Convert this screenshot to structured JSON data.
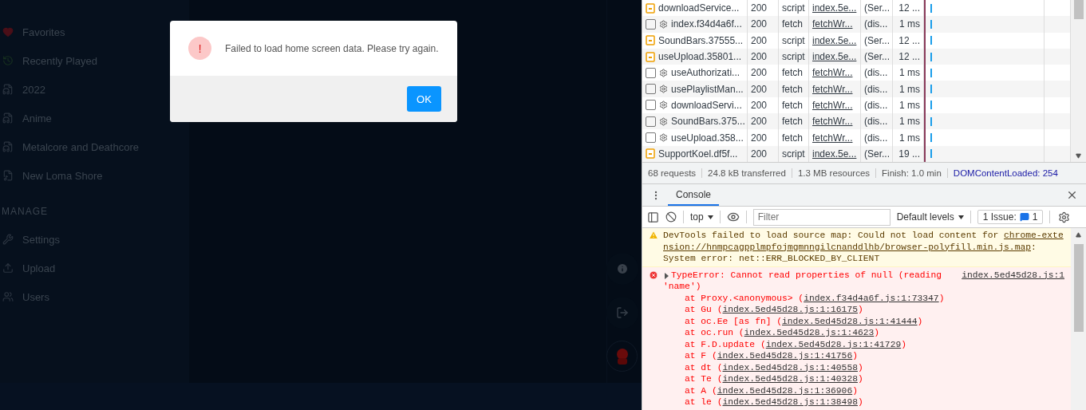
{
  "sidebar": {
    "items": [
      {
        "label": "Favorites",
        "kind": "favorites"
      },
      {
        "label": "Recently Played",
        "kind": "recent"
      },
      {
        "label": "2022",
        "kind": "smart"
      },
      {
        "label": "Anime",
        "kind": "smart"
      },
      {
        "label": "Metalcore and Deathcore",
        "kind": "smart"
      },
      {
        "label": "New Loma Shore",
        "kind": "playlist"
      }
    ],
    "manage_heading": "MANAGE",
    "manage_items": [
      {
        "label": "Settings",
        "kind": "settings"
      },
      {
        "label": "Upload",
        "kind": "upload"
      },
      {
        "label": "Users",
        "kind": "users"
      }
    ]
  },
  "dialog": {
    "message": "Failed to load home screen data. Please try again.",
    "icon": "!",
    "button": "OK"
  },
  "network": {
    "rows": [
      {
        "kind": "script",
        "name": "downloadService...",
        "status": "200",
        "type": "script",
        "initiator": "index.5e...",
        "size": "(Ser...",
        "time": "12 ..."
      },
      {
        "kind": "fetch",
        "name": "index.f34d4a6f...",
        "status": "200",
        "type": "fetch",
        "initiator": "fetchWr...",
        "size": "(dis...",
        "time": "1 ms"
      },
      {
        "kind": "script",
        "name": "SoundBars.37555...",
        "status": "200",
        "type": "script",
        "initiator": "index.5e...",
        "size": "(Ser...",
        "time": "12 ..."
      },
      {
        "kind": "script",
        "name": "useUpload.35801...",
        "status": "200",
        "type": "script",
        "initiator": "index.5e...",
        "size": "(Ser...",
        "time": "12 ..."
      },
      {
        "kind": "fetch",
        "name": "useAuthorizati...",
        "status": "200",
        "type": "fetch",
        "initiator": "fetchWr...",
        "size": "(dis...",
        "time": "1 ms"
      },
      {
        "kind": "fetch",
        "name": "usePlaylistMan...",
        "status": "200",
        "type": "fetch",
        "initiator": "fetchWr...",
        "size": "(dis...",
        "time": "1 ms"
      },
      {
        "kind": "fetch",
        "name": "downloadServi...",
        "status": "200",
        "type": "fetch",
        "initiator": "fetchWr...",
        "size": "(dis...",
        "time": "1 ms"
      },
      {
        "kind": "fetch",
        "name": "SoundBars.375...",
        "status": "200",
        "type": "fetch",
        "initiator": "fetchWr...",
        "size": "(dis...",
        "time": "1 ms"
      },
      {
        "kind": "fetch",
        "name": "useUpload.358...",
        "status": "200",
        "type": "fetch",
        "initiator": "fetchWr...",
        "size": "(dis...",
        "time": "1 ms"
      },
      {
        "kind": "script",
        "name": "SupportKoel.df5f...",
        "status": "200",
        "type": "script",
        "initiator": "index.5e...",
        "size": "(Ser...",
        "time": "19 ..."
      }
    ],
    "summary": [
      "68 requests",
      "24.8 kB transferred",
      "1.3 MB resources",
      "Finish: 1.0 min"
    ],
    "dom_content_loaded": "DOMContentLoaded: 254"
  },
  "console": {
    "tab": {
      "label": "Console",
      "selected": true
    },
    "context": "top",
    "filter_placeholder": "Filter",
    "levels": "Default levels",
    "issues_label": "1 Issue:",
    "issues_count": "1",
    "warning": {
      "lines": [
        [
          {
            "text": "DevTools failed to load source map: Could not load content for ",
            "link": false
          },
          {
            "text": "chrome-exte",
            "link": true
          }
        ],
        [
          {
            "text": "nsion://hnmpcagpplmpfojmgmnngilcnanddlhb/browser-polyfill.min.js.map",
            "link": true
          },
          {
            "text": ":",
            "link": false
          }
        ],
        [
          {
            "text": "System error: net::ERR_BLOCKED_BY_CLIENT",
            "link": false
          }
        ]
      ]
    },
    "error": {
      "expanded": false,
      "first_line": "TypeError: Cannot read properties of null (reading",
      "second_line": "'name')",
      "source": "index.5ed45d28.js:1",
      "stack": [
        {
          "prefix": "at Proxy.<anonymous> (",
          "link": "index.f34d4a6f.js:1:73347"
        },
        {
          "prefix": "at Gu (",
          "link": "index.5ed45d28.js:1:16175"
        },
        {
          "prefix": "at oc.Ee [as fn] (",
          "link": "index.5ed45d28.js:1:41444"
        },
        {
          "prefix": "at oc.run (",
          "link": "index.5ed45d28.js:1:4623"
        },
        {
          "prefix": "at F.D.update (",
          "link": "index.5ed45d28.js:1:41729"
        },
        {
          "prefix": "at F (",
          "link": "index.5ed45d28.js:1:41756"
        },
        {
          "prefix": "at dt (",
          "link": "index.5ed45d28.js:1:40558"
        },
        {
          "prefix": "at Te (",
          "link": "index.5ed45d28.js:1:40328"
        },
        {
          "prefix": "at A (",
          "link": "index.5ed45d28.js:1:36906"
        },
        {
          "prefix": "at le (",
          "link": "index.5ed45d28.js:1:38498"
        }
      ],
      "closing": ")"
    }
  }
}
